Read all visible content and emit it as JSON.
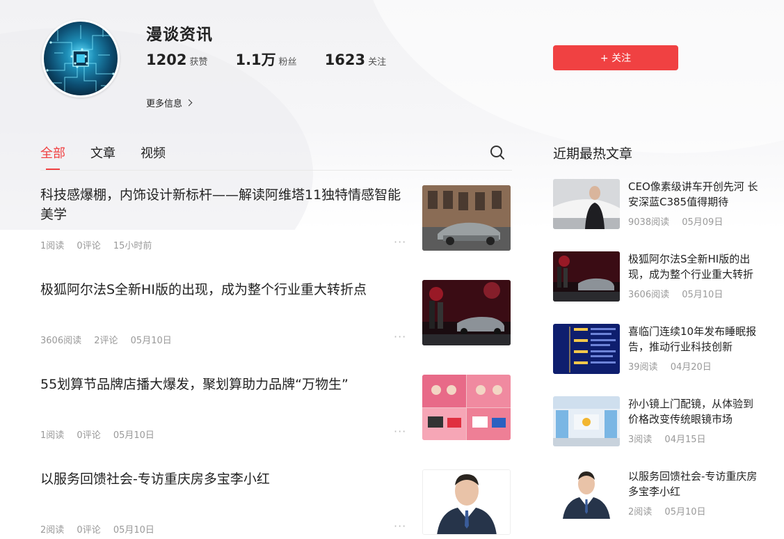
{
  "profile": {
    "name": "漫谈资讯",
    "likes_num": "1202",
    "likes_label": "获赞",
    "fans_num": "1.1万",
    "fans_label": "粉丝",
    "following_num": "1623",
    "following_label": "关注",
    "more_info": "更多信息",
    "follow_button": "+ 关注"
  },
  "tabs": [
    {
      "label": "全部",
      "active": true
    },
    {
      "label": "文章",
      "active": false
    },
    {
      "label": "视频",
      "active": false
    }
  ],
  "feed": [
    {
      "title": "科技感爆棚，内饰设计新标杆——解读阿维塔11独特情感智能美学",
      "reads": "1阅读",
      "comments": "0评论",
      "time": "15小时前",
      "thumb": "car-street-photo"
    },
    {
      "title": "极狐阿尔法S全新HI版的出现，成为整个行业重大转折点",
      "reads": "3606阅读",
      "comments": "2评论",
      "time": "05月10日",
      "thumb": "car-launch-stage-photo"
    },
    {
      "title": "55划算节品牌店播大爆发，聚划算助力品牌“万物生”",
      "reads": "1阅读",
      "comments": "0评论",
      "time": "05月10日",
      "thumb": "livestream-collage-photo"
    },
    {
      "title": "以服务回馈社会-专访重庆房多宝李小红",
      "reads": "2阅读",
      "comments": "0评论",
      "time": "05月10日",
      "thumb": "portrait-photo"
    }
  ],
  "feed_more_glyph": "···",
  "sidebar": {
    "title": "近期最热文章",
    "items": [
      {
        "title": "CEO像素级讲车开创先河 长安深蓝C385值得期待",
        "reads": "9038阅读",
        "date": "05月09日",
        "thumb": "ceo-car-photo"
      },
      {
        "title": "极狐阿尔法S全新HI版的出现，成为整个行业重大转折点",
        "reads": "3606阅读",
        "date": "05月10日",
        "thumb": "car-launch-stage-photo"
      },
      {
        "title": "喜临门连续10年发布睡眠报告，推动行业科技创新",
        "reads": "39阅读",
        "date": "04月20日",
        "thumb": "timeline-slide-photo"
      },
      {
        "title": "孙小镜上门配镜，从体验到价格改变传统眼镜市场",
        "reads": "3阅读",
        "date": "04月15日",
        "thumb": "store-interior-photo"
      },
      {
        "title": "以服务回馈社会-专访重庆房多宝李小红",
        "reads": "2阅读",
        "date": "05月10日",
        "thumb": "portrait-photo"
      }
    ]
  },
  "colors": {
    "accent": "#f04142",
    "meta_text": "#999999"
  }
}
